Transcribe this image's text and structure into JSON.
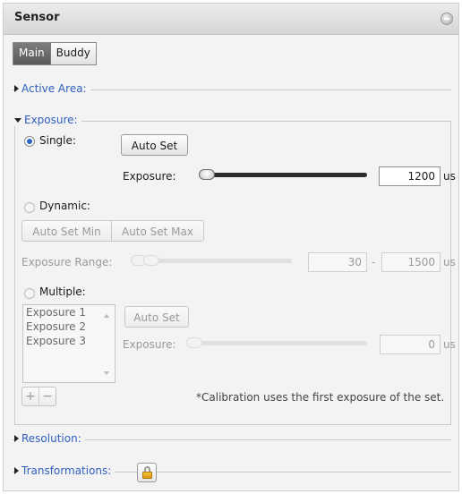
{
  "panel": {
    "title": "Sensor",
    "tabs": [
      {
        "label": "Main",
        "active": true
      },
      {
        "label": "Buddy",
        "active": false
      }
    ]
  },
  "sections": {
    "active_area": "Active Area:",
    "exposure": "Exposure:",
    "resolution": "Resolution:",
    "transformations": "Transformations:"
  },
  "exposure": {
    "single": {
      "label": "Single:",
      "selected": true,
      "auto_set": "Auto Set",
      "exposure_label": "Exposure:",
      "value": "1200",
      "unit": "us",
      "slider_level": 0
    },
    "dynamic": {
      "label": "Dynamic:",
      "selected": false,
      "auto_set_min": "Auto Set Min",
      "auto_set_max": "Auto Set Max",
      "range_label": "Exposure Range:",
      "min": "30",
      "separator": "-",
      "max": "1500",
      "unit": "us"
    },
    "multiple": {
      "label": "Multiple:",
      "selected": false,
      "items": [
        "Exposure 1",
        "Exposure 2",
        "Exposure 3"
      ],
      "auto_set": "Auto Set",
      "exposure_label": "Exposure:",
      "value": "0",
      "unit": "us",
      "add": "+",
      "remove": "−"
    },
    "note": "*Calibration uses the first exposure of the set."
  },
  "colors": {
    "section_link": "#2f5fbf",
    "radio_selected": "#2b63c6",
    "active_tab": "#5a5a5a"
  },
  "icons": {
    "collapse": "minus-circle-icon",
    "lock": "lock-icon"
  }
}
